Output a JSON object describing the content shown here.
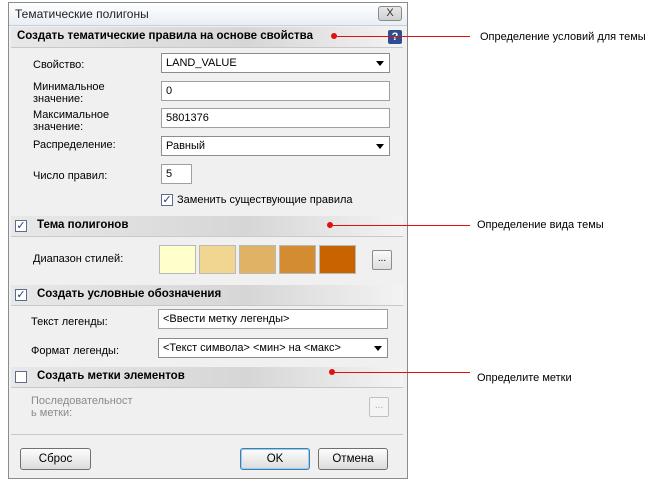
{
  "dialog": {
    "title": "Тематические полигоны",
    "close_glyph": "X",
    "help_glyph": "?"
  },
  "rules_section": {
    "title": "Создать тематические правила на основе свойства",
    "property_label": "Свойство:",
    "property_value": "LAND_VALUE",
    "min_label_line1": "Минимальное",
    "min_label_line2": "значение:",
    "min_value": "0",
    "max_label_line1": "Максимальное",
    "max_label_line2": "значение:",
    "max_value": "5801376",
    "distribution_label": "Распределение:",
    "distribution_value": "Равный",
    "rule_count_label": "Число правил:",
    "rule_count_value": "5",
    "replace_checkbox_label": "Заменить существующие правила",
    "replace_checked": true
  },
  "theme_section": {
    "title": "Тема полигонов",
    "checked": true,
    "style_range_label": "Диапазон стилей:",
    "swatches": [
      "#ffffcc",
      "#f0d690",
      "#e0b266",
      "#d48c33",
      "#c86400"
    ],
    "browse_glyph": "..."
  },
  "legend_section": {
    "title": "Создать условные обозначения",
    "checked": true,
    "legend_text_label": "Текст легенды:",
    "legend_text_value": "<Ввести метку легенды>",
    "legend_format_label": "Формат легенды:",
    "legend_format_value": "<Текст символа> <мин> на <макс>"
  },
  "labels_section": {
    "title": "Создать метки элементов",
    "checked": false,
    "sequence_label_line1": "Последовательност",
    "sequence_label_line2": "ь метки:",
    "browse_glyph": "..."
  },
  "footer": {
    "reset_label": "Сброс",
    "ok_label": "OK",
    "cancel_label": "Отмена"
  },
  "annotations": {
    "conditions": "Определение условий для темы",
    "view": "Определение вида темы",
    "labels": "Определите метки"
  },
  "colors": {
    "callout": "#e01010",
    "help_icon": "#2d4f8f"
  }
}
